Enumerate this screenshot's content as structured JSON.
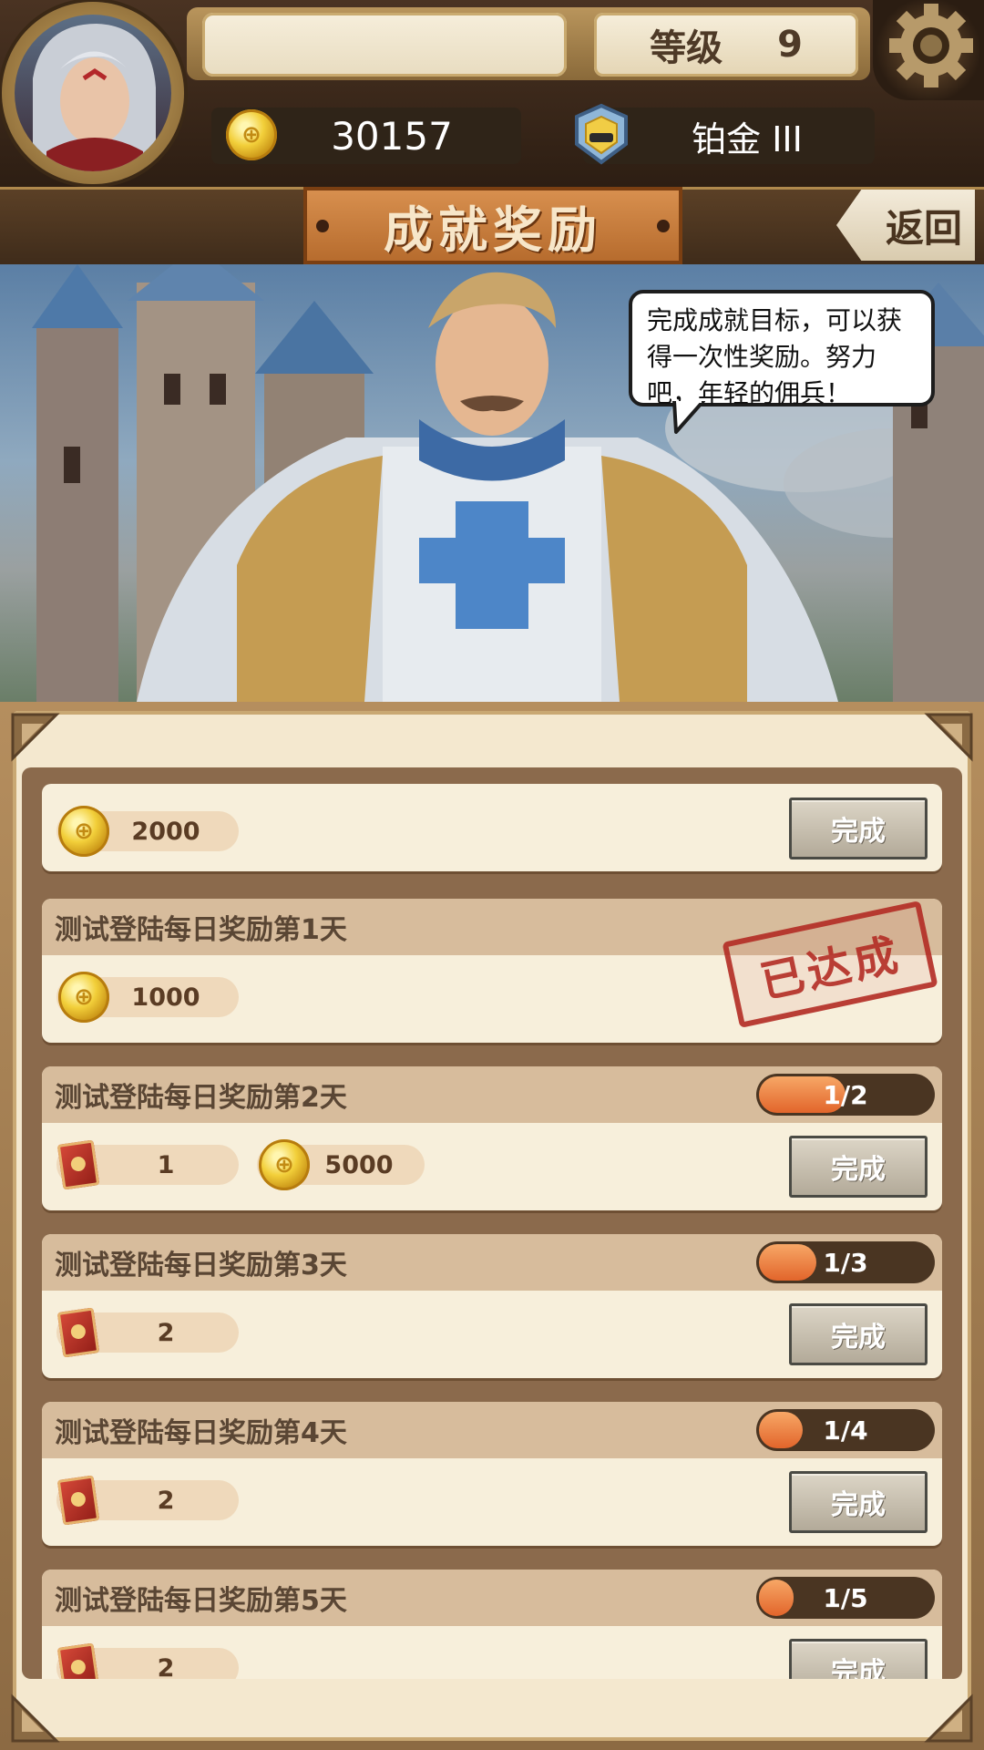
{
  "header": {
    "level_label": "等级",
    "level_value": "9",
    "gold": "30157",
    "rank": "铂金 III"
  },
  "title": "成就奖励",
  "back_label": "返回",
  "speech_text": "完成成就目标，可以获得一次性奖励。努力吧，年轻的佣兵！",
  "stamp_text": "已达成",
  "colors": {
    "accent_orange": "#e2652b",
    "panel_bg": "#f4e8cf",
    "stamp_red": "#b32b24"
  },
  "icons": {
    "coin": "gold-coin-icon",
    "book": "red-card-book-icon",
    "rank": "platinum-rank-badge-icon",
    "settings": "gear-icon"
  },
  "achievements": [
    {
      "title": "",
      "rewards": [
        {
          "icon": "coin",
          "amount": "2000"
        }
      ],
      "progress": "",
      "progress_fraction": 0,
      "button": "完成",
      "completed": false
    },
    {
      "title": "测试登陆每日奖励第1天",
      "rewards": [
        {
          "icon": "coin",
          "amount": "1000"
        }
      ],
      "progress": "",
      "progress_fraction": 1,
      "button": "",
      "completed": true
    },
    {
      "title": "测试登陆每日奖励第2天",
      "rewards": [
        {
          "icon": "book",
          "amount": "1"
        },
        {
          "icon": "coin",
          "amount": "5000"
        }
      ],
      "progress": "1/2",
      "progress_fraction": 0.5,
      "button": "完成",
      "completed": false
    },
    {
      "title": "测试登陆每日奖励第3天",
      "rewards": [
        {
          "icon": "book",
          "amount": "2"
        }
      ],
      "progress": "1/3",
      "progress_fraction": 0.3333,
      "button": "完成",
      "completed": false
    },
    {
      "title": "测试登陆每日奖励第4天",
      "rewards": [
        {
          "icon": "book",
          "amount": "2"
        }
      ],
      "progress": "1/4",
      "progress_fraction": 0.25,
      "button": "完成",
      "completed": false
    },
    {
      "title": "测试登陆每日奖励第5天",
      "rewards": [
        {
          "icon": "book",
          "amount": "2"
        }
      ],
      "progress": "1/5",
      "progress_fraction": 0.2,
      "button": "完成",
      "completed": false
    }
  ]
}
